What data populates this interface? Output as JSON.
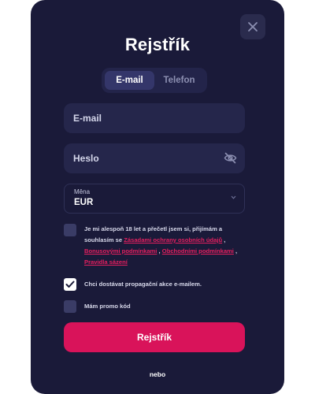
{
  "title": "Rejstřík",
  "close_icon": "close-icon",
  "tabs": [
    {
      "label": "E-mail",
      "active": true
    },
    {
      "label": "Telefon",
      "active": false
    }
  ],
  "fields": {
    "email": {
      "placeholder": "E-mail",
      "value": ""
    },
    "password": {
      "placeholder": "Heslo",
      "value": "",
      "icon": "eye-off-icon"
    }
  },
  "currency": {
    "label": "Měna",
    "value": "EUR",
    "icon": "chevron-down-icon"
  },
  "terms": {
    "checked": false,
    "text_prefix": "Je mi alespoň 18 let a přečetl jsem si, přijímám a souhlasím se",
    "link_privacy": "Zásadami ochrany osobních údajů",
    "sep1": ",",
    "link_bonus": "Bonusovými podmínkami",
    "sep2": ",",
    "link_terms": "Obchodními podmínkami",
    "sep3": ",",
    "link_betting": "Pravidla sázení"
  },
  "promo_emails": {
    "checked": true,
    "label": "Chci dostávat propagační akce e-mailem."
  },
  "promo_code": {
    "checked": false,
    "label": "Mám promo kód"
  },
  "submit_label": "Rejstřík",
  "footer_text": "nebo",
  "colors": {
    "background": "#1a1a39",
    "field": "#25264b",
    "accent": "#d9135a",
    "link": "#e51f5f"
  }
}
